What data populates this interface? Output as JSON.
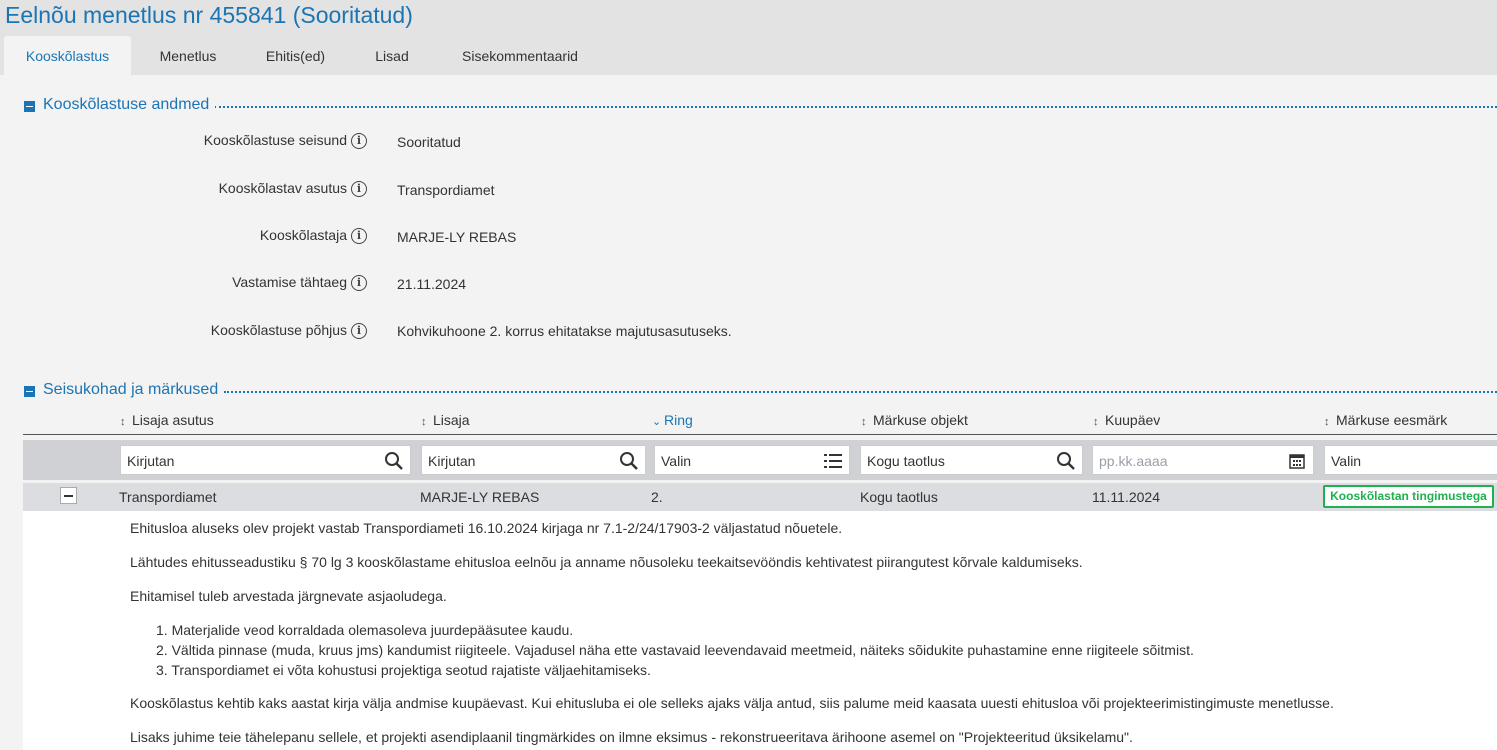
{
  "page": {
    "title": "Eelnõu menetlus nr 455841 (Sooritatud)"
  },
  "tabs": [
    {
      "label": "Kooskõlastus",
      "active": true
    },
    {
      "label": "Menetlus"
    },
    {
      "label": "Ehitis(ed)"
    },
    {
      "label": "Lisad"
    },
    {
      "label": "Sisekommentaarid"
    }
  ],
  "section_details": {
    "title": "Kooskõlastuse andmed",
    "fields": [
      {
        "label": "Kooskõlastuse seisund",
        "value": "Sooritatud"
      },
      {
        "label": "Kooskõlastav asutus",
        "value": "Transpordiamet"
      },
      {
        "label": "Kooskõlastaja",
        "value": "MARJE-LY REBAS"
      },
      {
        "label": "Vastamise tähtaeg",
        "value": "21.11.2024"
      },
      {
        "label": "Kooskõlastuse põhjus",
        "value": "Kohvikuhoone 2. korrus ehitatakse majutusasutuseks."
      }
    ]
  },
  "section_remarks": {
    "title": "Seisukohad ja märkused",
    "columns": [
      {
        "label": "Lisaja asutus",
        "sort": "none"
      },
      {
        "label": "Lisaja",
        "sort": "none"
      },
      {
        "label": "Ring",
        "sort": "desc"
      },
      {
        "label": "Märkuse objekt",
        "sort": "none"
      },
      {
        "label": "Kuupäev",
        "sort": "none"
      },
      {
        "label": "Märkuse eesmärk",
        "sort": "none"
      }
    ],
    "filters": [
      {
        "placeholder": "Kirjutan",
        "icon": "search-icon"
      },
      {
        "placeholder": "Kirjutan",
        "icon": "search-icon"
      },
      {
        "placeholder": "Valin",
        "icon": "list-icon"
      },
      {
        "placeholder": "Kogu taotlus",
        "icon": "search-icon"
      },
      {
        "placeholder": "pp.kk.aaaa",
        "icon": "calendar-icon"
      },
      {
        "placeholder": "Valin"
      }
    ],
    "row": {
      "institution": "Transpordiamet",
      "author": "MARJE-LY REBAS",
      "round": "2.",
      "object": "Kogu taotlus",
      "date": "11.11.2024",
      "purpose": "Kooskõlastan tingimustega",
      "purpose_color": "#1fb14f"
    },
    "detail": {
      "paragraphs": [
        "Ehitusloa aluseks olev projekt vastab Transpordiameti 16.10.2024 kirjaga nr 7.1-2/24/17903-2 väljastatud nõuetele.",
        "Lähtudes ehitusseadustiku § 70 lg 3 kooskõlastame ehitusloa eelnõu ja anname nõusoleku teekaitsevööndis kehtivatest piirangutest kõrvale kaldumiseks.",
        "Ehitamisel tuleb arvestada järgnevate asjaoludega."
      ],
      "list": [
        "1. Materjalide veod korraldada olemasoleva juurdepääsutee kaudu.",
        "2. Vältida pinnase (muda, kruus jms) kandumist riigiteele. Vajadusel näha ette vastavaid leevendavaid meetmeid, näiteks sõidukite puhastamine enne riigiteele sõitmist.",
        "3. Transpordiamet ei võta kohustusi projektiga seotud rajatiste väljaehitamiseks."
      ],
      "closing": [
        "Kooskõlastus kehtib kaks aastat kirja välja andmise kuupäevast. Kui ehitusluba ei ole selleks ajaks välja antud, siis palume meid kaasata uuesti ehitusloa või projekteerimistingimuste menetlusse.",
        "Lisaks juhime teie tähelepanu sellele, et projekti asendiplaanil tingmärkides on ilmne eksimus - rekonstrueeritava ärihoone asemel on \"Projekteeritud üksikelamu\"."
      ]
    }
  },
  "colors": {
    "accent": "#1b75b4",
    "success": "#1fb14f"
  }
}
